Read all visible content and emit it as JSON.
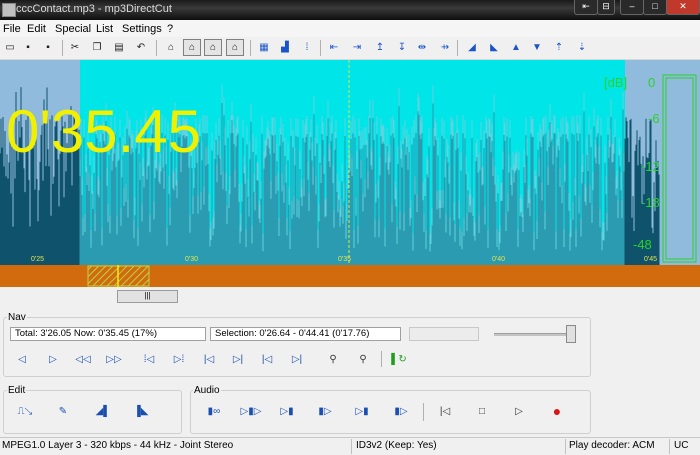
{
  "window": {
    "title": "cccContact.mp3 - mp3DirectCut"
  },
  "menu": [
    "File",
    "Edit",
    "Special",
    "List",
    "Settings",
    "?"
  ],
  "wave": {
    "time_display": "0'35.45",
    "ticks": [
      "0'25",
      "0'30",
      "0'35",
      "0'40",
      "0'45"
    ],
    "db_labels": [
      "[dB]",
      "0",
      "-6",
      "-12",
      "-18",
      "-48"
    ],
    "colors": {
      "background": "#0e536b",
      "selection": "#00e5e8",
      "waveform": "#45c6d6",
      "time_text": "#f0f000",
      "db_text": "#2bd12b",
      "timeline": "#d26b0e"
    }
  },
  "nav": {
    "label": "Nav",
    "total_now": "Total: 3'26.05   Now: 0'35.45   (17%)",
    "selection": "Selection: 0'26.64 - 0'44.41 (0'17.76)"
  },
  "edit": {
    "label": "Edit"
  },
  "audio": {
    "label": "Audio"
  },
  "status": {
    "format": "MPEG1.0 Layer 3 - 320 kbps - 44 kHz - Joint Stereo",
    "id3": "ID3v2 (Keep: Yes)",
    "decoder": "Play decoder: ACM",
    "mode": "UC"
  }
}
